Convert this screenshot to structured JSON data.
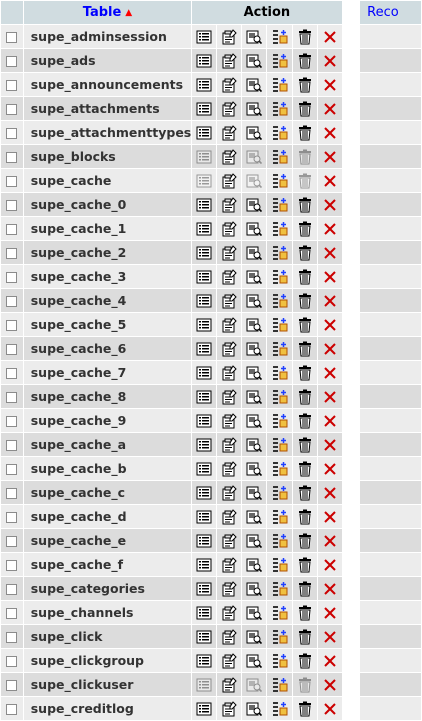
{
  "header": {
    "table_label": "Table",
    "sort_indicator": "▲",
    "action_label": "Action",
    "records_label_partial": "Reco"
  },
  "icons": {
    "browse": "browse-icon",
    "structure": "structure-icon",
    "search": "search-icon",
    "insert": "insert-icon",
    "empty": "empty-icon",
    "drop": "drop-icon"
  },
  "colors": {
    "header_bg": "#d0dce0",
    "row_odd": "#ececec",
    "row_even": "#dcdcdc",
    "link_blue": "#0000ff",
    "drop_red": "#cc0000"
  },
  "rows": [
    {
      "name": "supe_adminsession",
      "empty": false
    },
    {
      "name": "supe_ads",
      "empty": false
    },
    {
      "name": "supe_announcements",
      "empty": false
    },
    {
      "name": "supe_attachments",
      "empty": false
    },
    {
      "name": "supe_attachmenttypes",
      "empty": false
    },
    {
      "name": "supe_blocks",
      "empty": true
    },
    {
      "name": "supe_cache",
      "empty": true
    },
    {
      "name": "supe_cache_0",
      "empty": false
    },
    {
      "name": "supe_cache_1",
      "empty": false
    },
    {
      "name": "supe_cache_2",
      "empty": false
    },
    {
      "name": "supe_cache_3",
      "empty": false
    },
    {
      "name": "supe_cache_4",
      "empty": false
    },
    {
      "name": "supe_cache_5",
      "empty": false
    },
    {
      "name": "supe_cache_6",
      "empty": false
    },
    {
      "name": "supe_cache_7",
      "empty": false
    },
    {
      "name": "supe_cache_8",
      "empty": false
    },
    {
      "name": "supe_cache_9",
      "empty": false
    },
    {
      "name": "supe_cache_a",
      "empty": false
    },
    {
      "name": "supe_cache_b",
      "empty": false
    },
    {
      "name": "supe_cache_c",
      "empty": false
    },
    {
      "name": "supe_cache_d",
      "empty": false
    },
    {
      "name": "supe_cache_e",
      "empty": false
    },
    {
      "name": "supe_cache_f",
      "empty": false
    },
    {
      "name": "supe_categories",
      "empty": false
    },
    {
      "name": "supe_channels",
      "empty": false
    },
    {
      "name": "supe_click",
      "empty": false
    },
    {
      "name": "supe_clickgroup",
      "empty": false
    },
    {
      "name": "supe_clickuser",
      "empty": true
    },
    {
      "name": "supe_creditlog",
      "empty": false
    }
  ]
}
